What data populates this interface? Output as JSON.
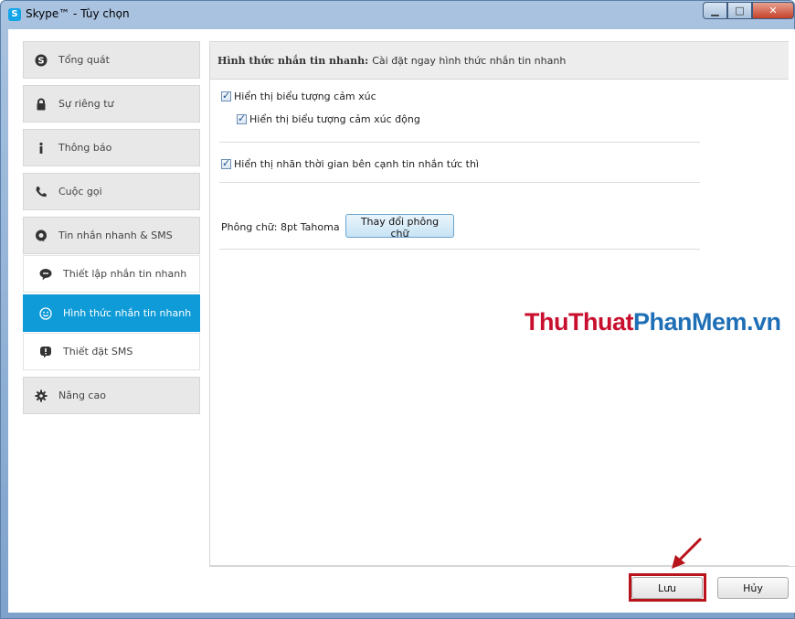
{
  "window": {
    "title": "Skype™ - Tùy chọn",
    "app_icon_letter": "S",
    "controls": {
      "minimize": "▁",
      "maximize": "□",
      "close": "✕"
    }
  },
  "sidebar": {
    "items": [
      {
        "label": "Tổng quát",
        "icon": "skype-icon"
      },
      {
        "label": "Sự riêng tư",
        "icon": "lock-icon"
      },
      {
        "label": "Thông báo",
        "icon": "info-icon"
      },
      {
        "label": "Cuộc gọi",
        "icon": "phone-icon"
      },
      {
        "label": "Tin nhắn nhanh & SMS",
        "icon": "chat-icon"
      },
      {
        "label": "Thiết lập nhắn tin nhanh",
        "icon": "chat-bubble-icon"
      },
      {
        "label": "Hình thức nhắn tin nhanh",
        "icon": "smiley-icon",
        "active": true
      },
      {
        "label": "Thiết đặt SMS",
        "icon": "sms-icon"
      },
      {
        "label": "Nâng cao",
        "icon": "gear-icon"
      }
    ]
  },
  "content": {
    "header_bold": "Hình thức nhắn tin nhanh:",
    "header_text": "Cài đặt ngay hình thức nhắn tin nhanh",
    "options": {
      "show_emoticons": {
        "label": "Hiển thị biểu tượng cảm xúc",
        "checked": true
      },
      "show_animated": {
        "label": "Hiển thị biểu tượng cảm xúc động",
        "checked": true
      },
      "show_timestamp": {
        "label": "Hiển thị nhãn thời gian bên cạnh tin nhắn tức thì",
        "checked": true
      }
    },
    "font_label": "Phông chữ: 8pt Tahoma",
    "change_font_button": "Thay đổi phông chữ"
  },
  "watermark": {
    "part1": "ThuThuat",
    "part2": "PhanMem.vn"
  },
  "footer": {
    "save": "Lưu",
    "cancel": "Hủy"
  },
  "colors": {
    "accent": "#0f9bd7",
    "highlight": "#b8141b"
  }
}
